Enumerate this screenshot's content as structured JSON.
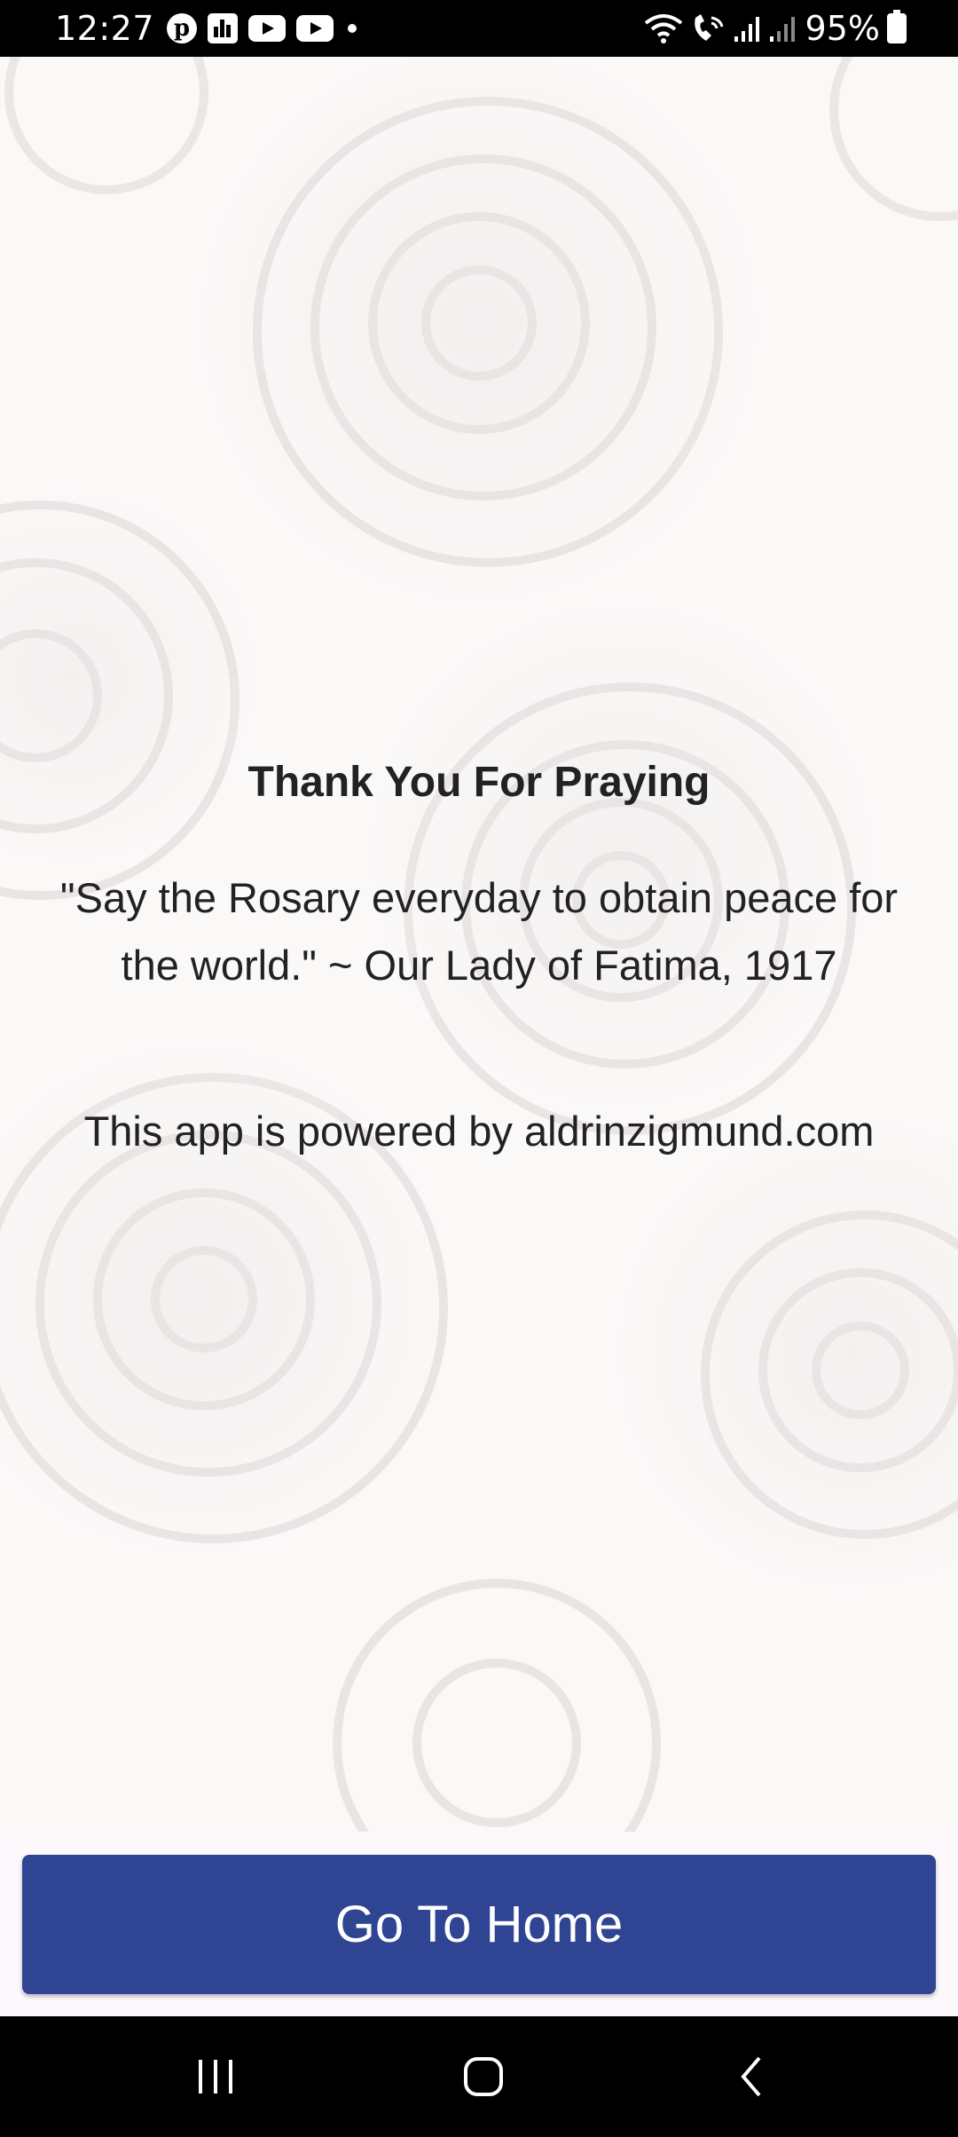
{
  "status_bar": {
    "time": "12:27",
    "notification_icons": [
      "pinterest-icon",
      "stats-icon",
      "youtube-icon",
      "youtube-icon",
      "dot-icon"
    ],
    "system_icons": [
      "wifi-icon",
      "wifi-call-icon",
      "signal-icon",
      "signal-icon"
    ],
    "battery": "95%"
  },
  "message": {
    "title": "Thank You For Praying",
    "quote": "\"Say the Rosary everyday to obtain peace for the world.\" ~ Our Lady of Fatima, 1917",
    "powered_by": "This app is powered by aldrinzigmund.com"
  },
  "actions": {
    "home_button_label": "Go To Home"
  },
  "colors": {
    "button": "#2f4593",
    "background": "#fbf8f8",
    "text": "#222222"
  },
  "navigation": {
    "buttons": [
      "recents-icon",
      "home-icon",
      "back-icon"
    ]
  }
}
